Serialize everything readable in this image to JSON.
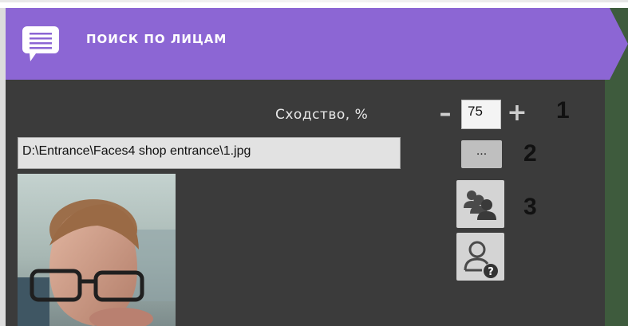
{
  "header": {
    "title": "ПОИСК ПО ЛИЦАМ",
    "icon": "panel-list-icon"
  },
  "similarity": {
    "label": "Сходство, %",
    "value": "75",
    "minus": "–",
    "plus": "+"
  },
  "file": {
    "path": "D:\\Entrance\\Faces4 shop entrance\\1.jpg",
    "browse_label": "..."
  },
  "buttons": {
    "find_faces_icon": "people-search-icon",
    "unknown_face_icon": "person-question-icon"
  },
  "callouts": [
    "1",
    "2",
    "3"
  ],
  "photo": {
    "description_icon": "face-photo"
  },
  "colors": {
    "header": "#8c66d4",
    "panel": "#3b3b3b",
    "accent_green": "#3e5b3d"
  }
}
